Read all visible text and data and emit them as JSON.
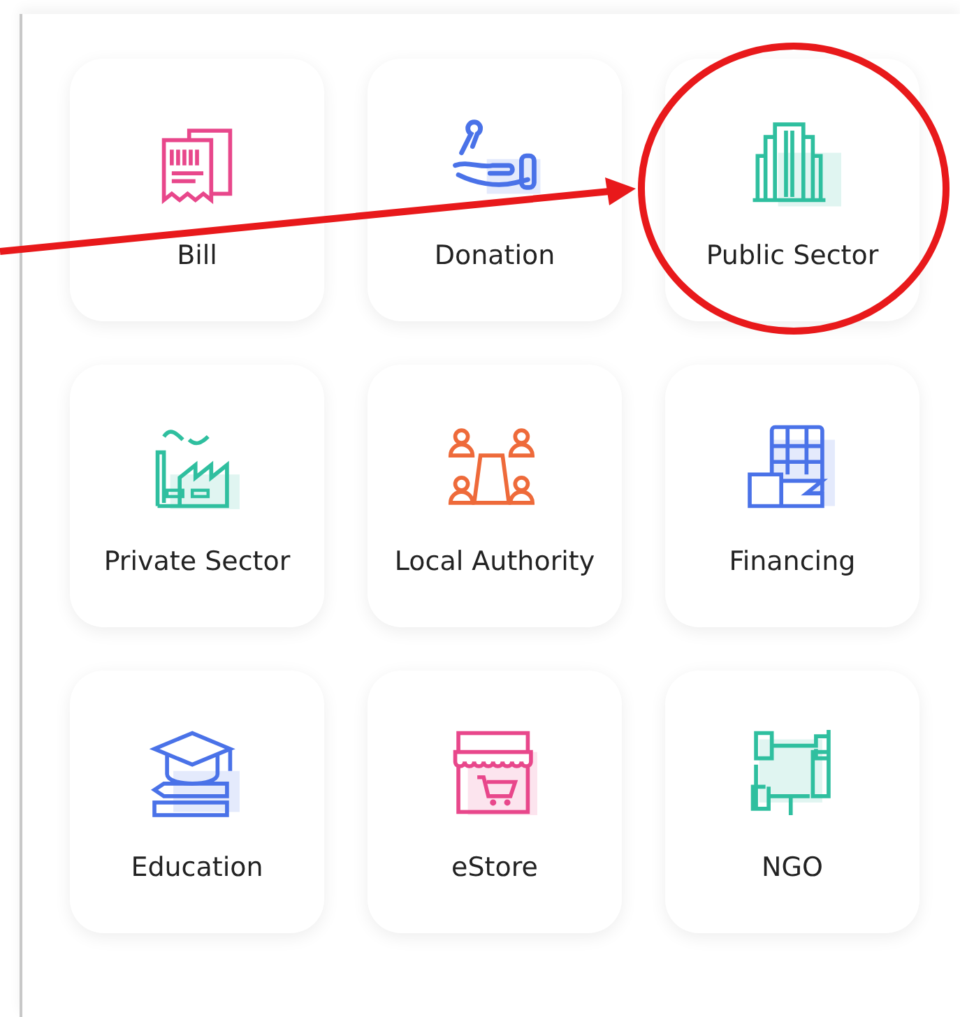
{
  "tiles": [
    {
      "label": "Bill",
      "color": "#e8478b",
      "highlighted": false
    },
    {
      "label": "Donation",
      "color": "#4a72e8",
      "highlighted": false
    },
    {
      "label": "Public Sector",
      "color": "#2fbf9f",
      "highlighted": true
    },
    {
      "label": "Private Sector",
      "color": "#2fbf9f",
      "highlighted": false
    },
    {
      "label": "Local Authority",
      "color": "#ee6a3a",
      "highlighted": false
    },
    {
      "label": "Financing",
      "color": "#4a72e8",
      "highlighted": false
    },
    {
      "label": "Education",
      "color": "#4a72e8",
      "highlighted": false
    },
    {
      "label": "eStore",
      "color": "#e8478b",
      "highlighted": false
    },
    {
      "label": "NGO",
      "color": "#2fbf9f",
      "highlighted": false
    }
  ]
}
